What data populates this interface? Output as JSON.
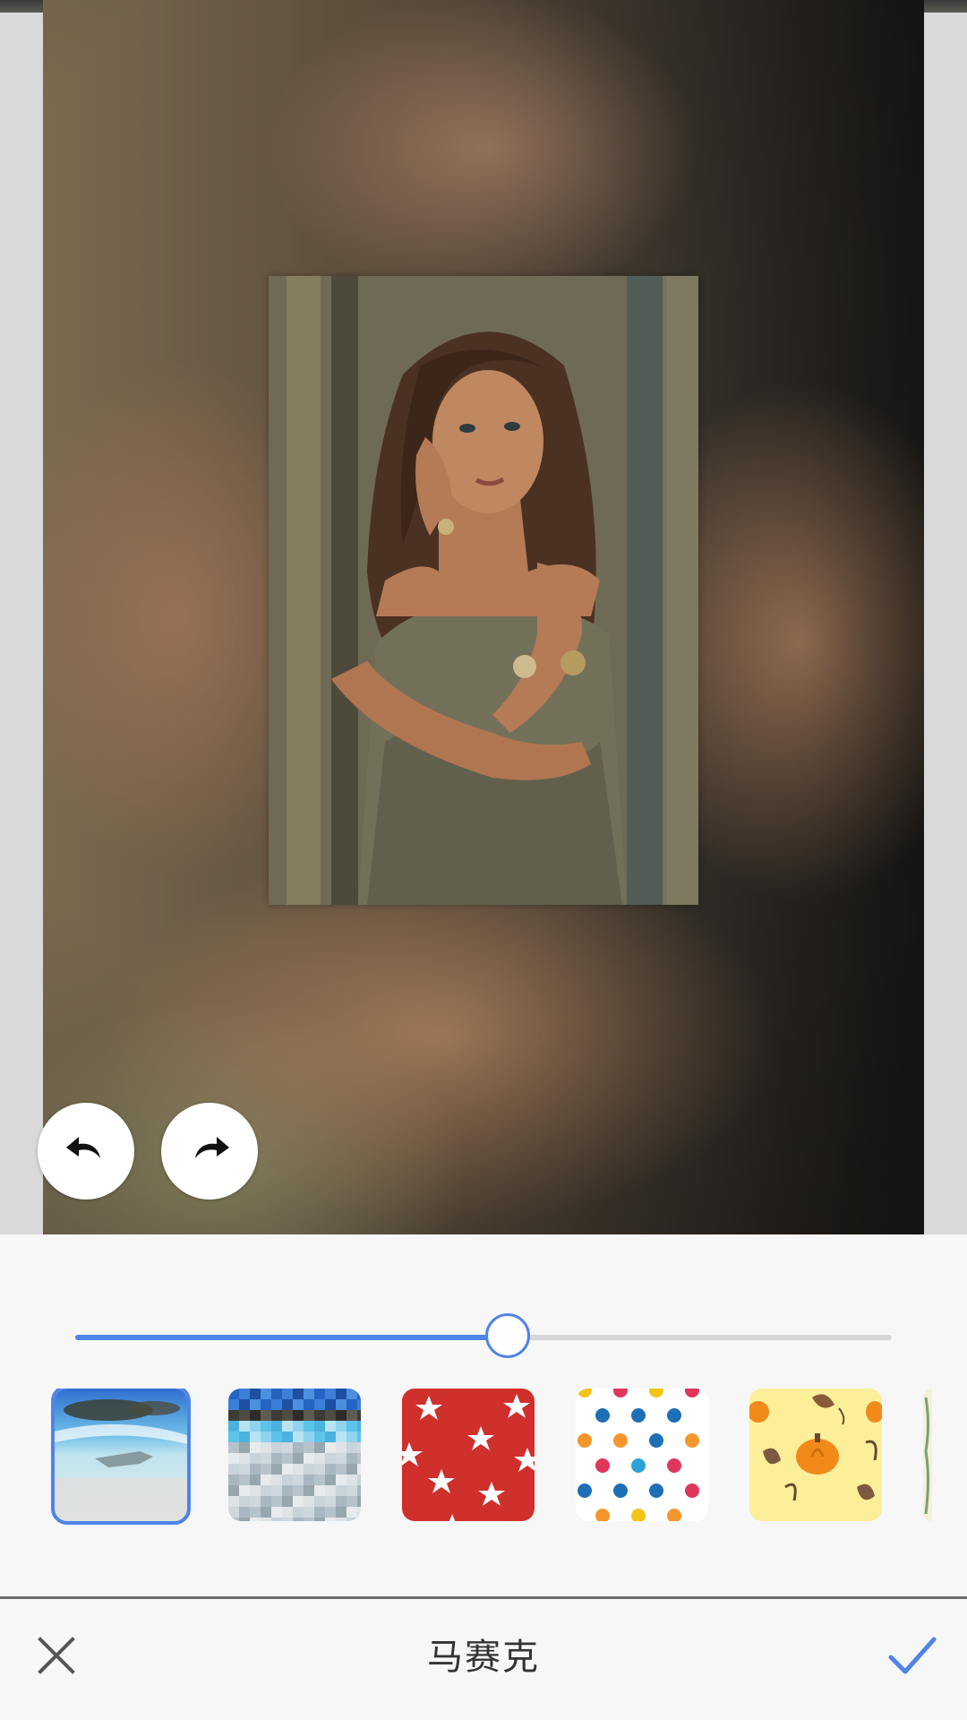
{
  "toolbar": {
    "title": "马赛克",
    "cancel_icon": "close-icon",
    "confirm_icon": "checkmark-icon"
  },
  "history": {
    "undo_icon": "undo-icon",
    "redo_icon": "redo-icon"
  },
  "slider": {
    "value_fraction": 0.53
  },
  "patterns": [
    {
      "name": "blurred-beach-photo",
      "selected": true
    },
    {
      "name": "pixelated-mosaic",
      "selected": false
    },
    {
      "name": "red-stars",
      "selected": false
    },
    {
      "name": "colored-polka-dots",
      "selected": false
    },
    {
      "name": "pumpkins-and-leaves",
      "selected": false
    },
    {
      "name": "partially-visible-pattern",
      "selected": false
    }
  ],
  "colors": {
    "accent": "#4f84e8",
    "title_text": "#333333",
    "panel_bg": "#f7f7f8"
  }
}
